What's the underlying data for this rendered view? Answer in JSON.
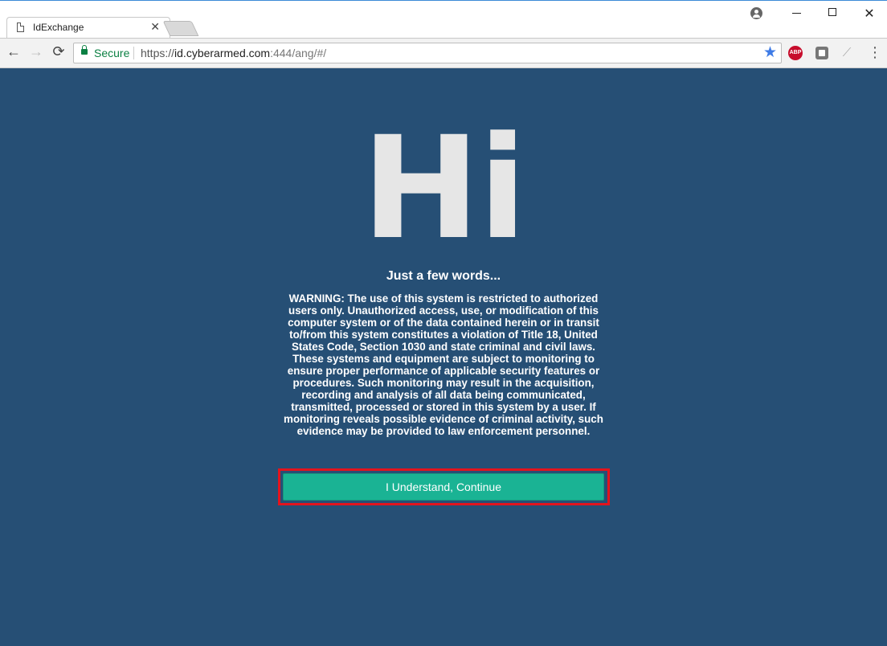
{
  "browser": {
    "tab": {
      "title": "IdExchange",
      "close_label": "✕"
    },
    "window_controls": {
      "minimize": "—",
      "maximize": "☐",
      "close": "✕"
    },
    "nav": {
      "back": "←",
      "forward": "→",
      "reload": "⟳"
    },
    "omnibox": {
      "secure_label": "Secure",
      "url_scheme": "https://",
      "url_host": "id.cyberarmed.com",
      "url_rest": ":444/ang/#/"
    },
    "extensions": {
      "abp_label": "ABP"
    },
    "icons": {
      "profile": "profile-icon",
      "lock": "lock-icon",
      "star": "star-icon",
      "menu": "kebab-menu-icon"
    }
  },
  "page": {
    "heading": "Hi",
    "subheading": "Just a few words...",
    "warning_text": "WARNING: The use of this system is restricted to authorized users only. Unauthorized access, use, or modification of this computer system or of the data contained herein or in transit to/from this system constitutes a violation of Title 18, United States Code, Section 1030 and state criminal and civil laws. These systems and equipment are subject to monitoring to ensure proper performance of applicable security features or procedures. Such monitoring may result in the acquisition, recording and analysis of all data being communicated, transmitted, processed or stored in this system by a user. If monitoring reveals possible evidence of criminal activity, such evidence may be provided to law enforcement personnel.",
    "continue_button_label": "I Understand, Continue"
  },
  "colors": {
    "page_background": "#264f75",
    "button": "#1ab394",
    "highlight": "#e3141d",
    "secure": "#0b8043"
  }
}
